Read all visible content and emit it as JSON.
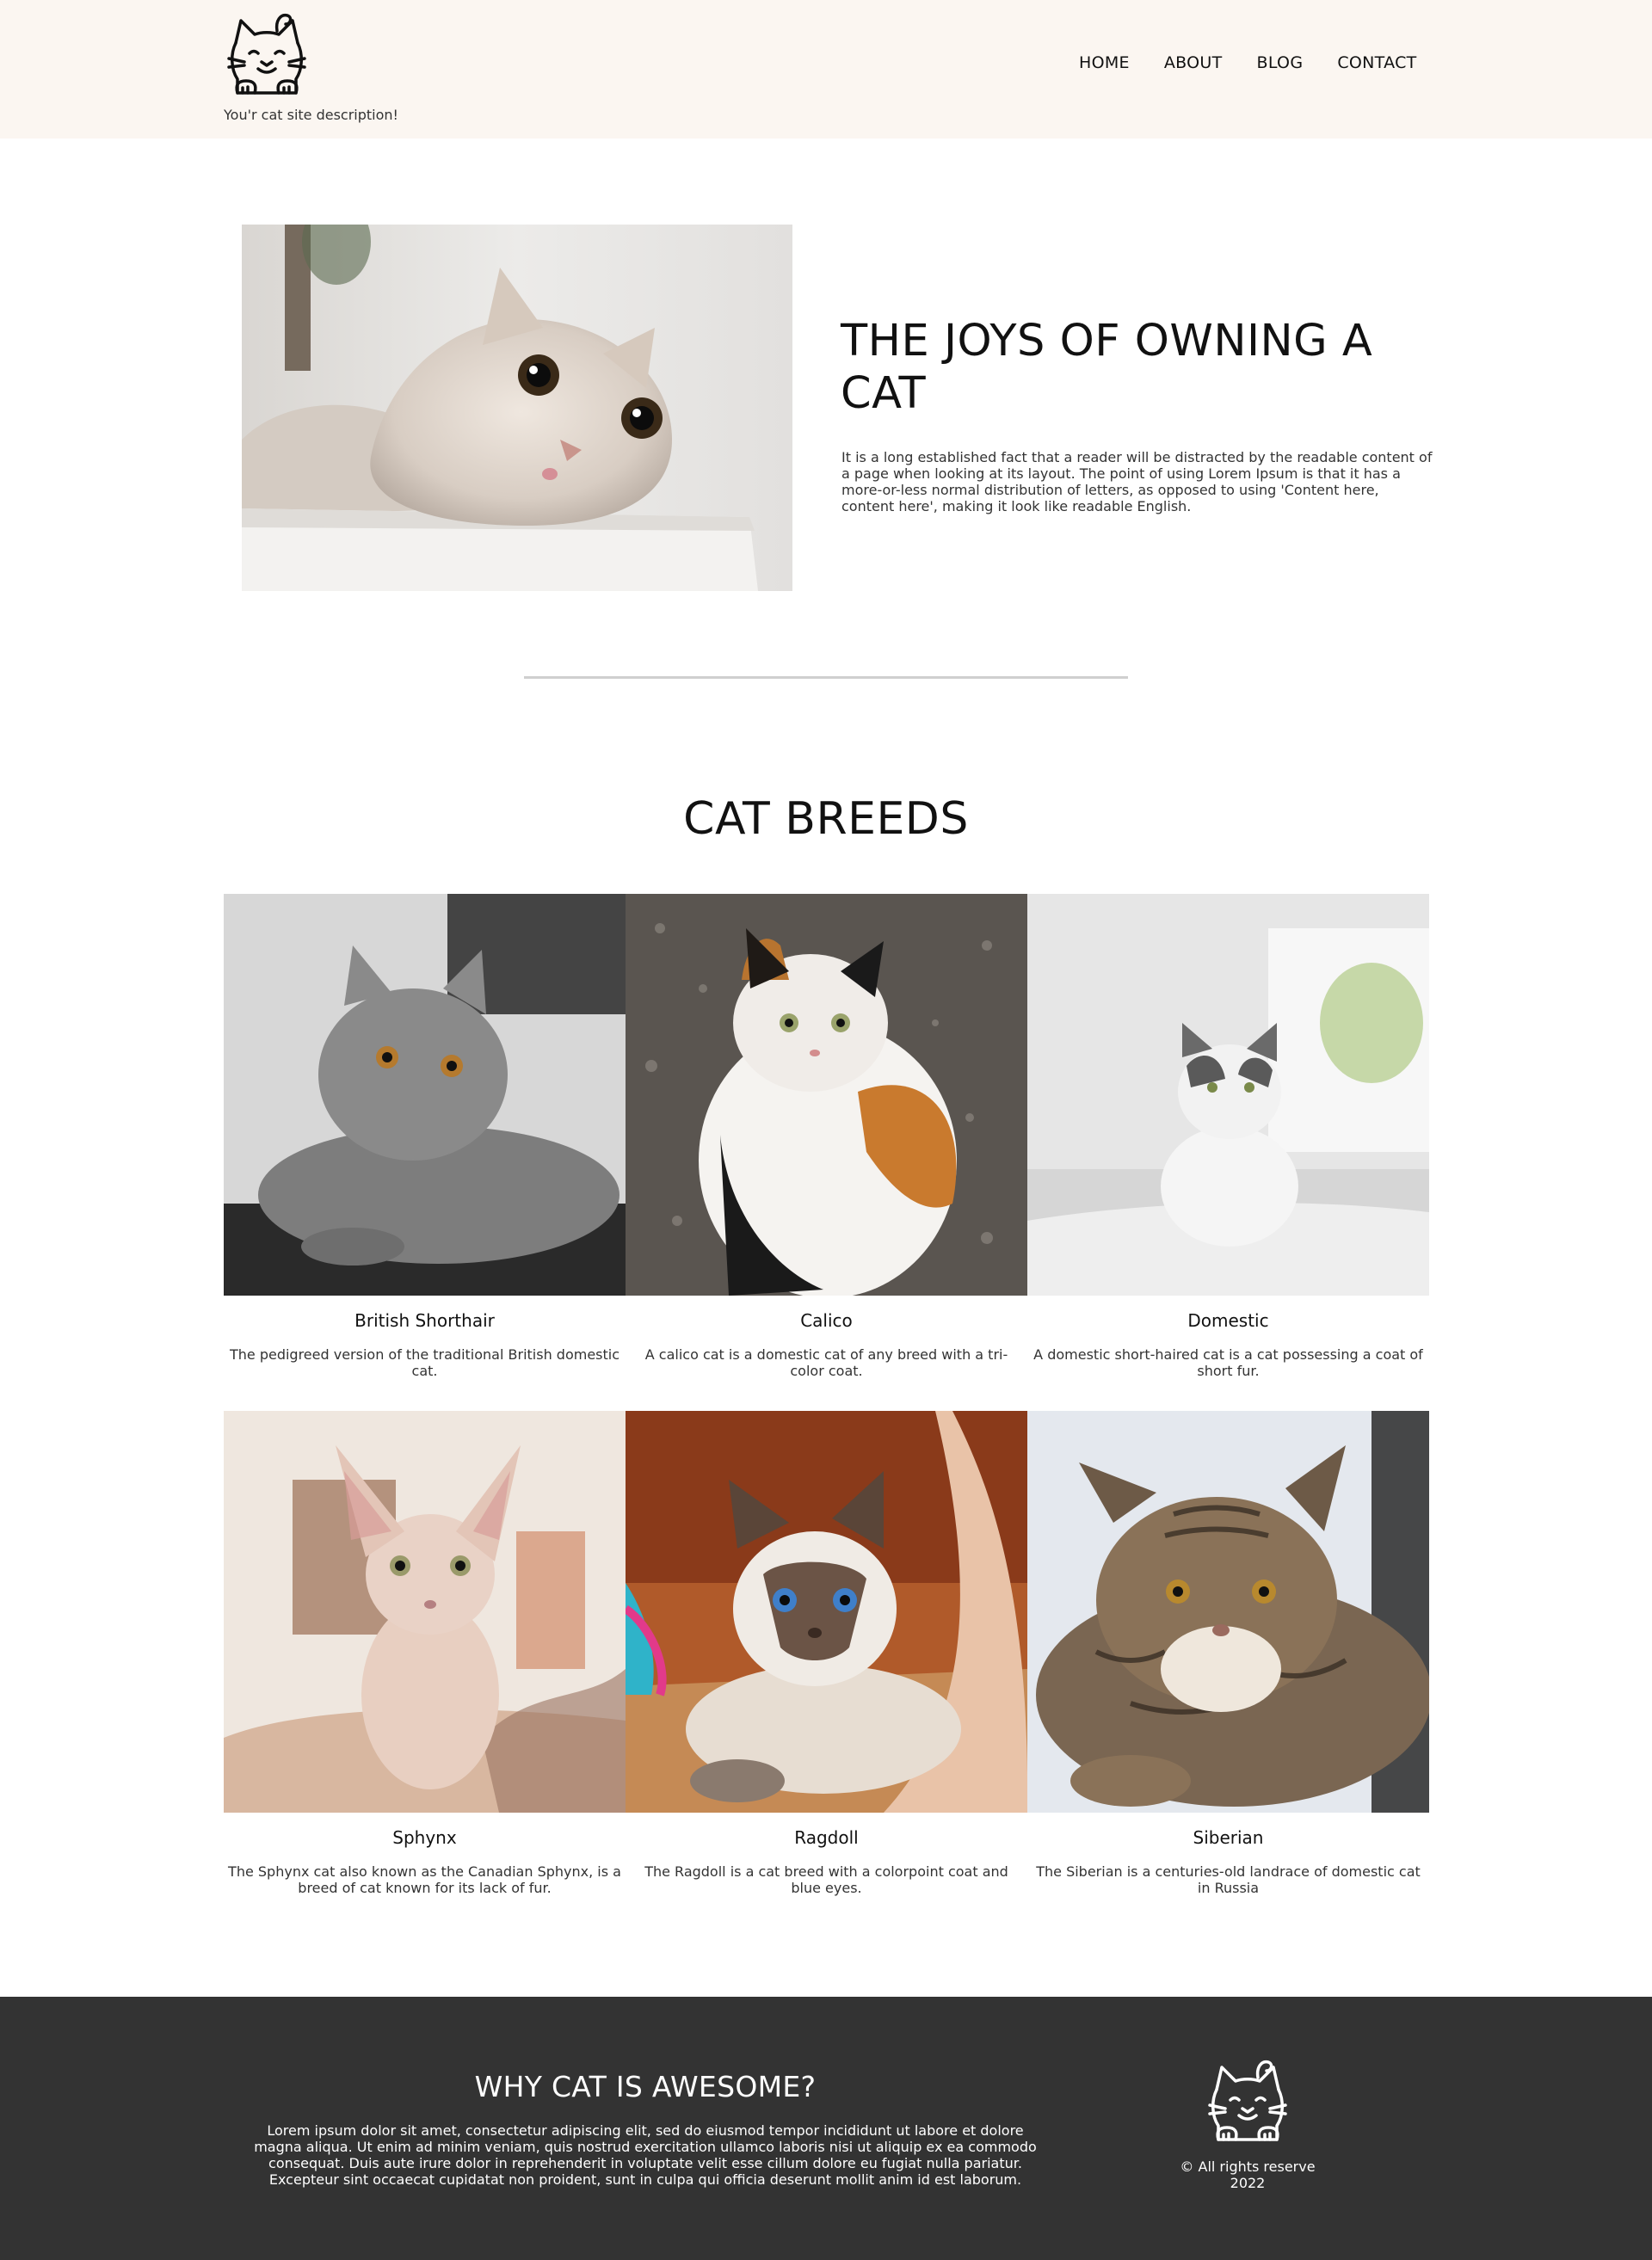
{
  "header": {
    "logo_icon": "cat-face-icon",
    "description": "You'r cat site description!",
    "nav": [
      {
        "label": "HOME"
      },
      {
        "label": "ABOUT"
      },
      {
        "label": "BLOG"
      },
      {
        "label": "CONTACT"
      }
    ]
  },
  "hero": {
    "title": "THE JOYS OF OWNING A CAT",
    "text": "It is a long established fact that a reader will be distracted by the readable content of a page when looking at its layout. The point of using Lorem Ipsum is that it has a more-or-less normal distribution of letters, as opposed to using 'Content here, content here', making it look like readable English.",
    "image": "scottish-fold-cat-photo"
  },
  "breeds": {
    "title": "CAT BREEDS",
    "items": [
      {
        "name": "British Shorthair",
        "description": "The pedigreed version of the traditional British domestic cat.",
        "image": "british-shorthair-photo"
      },
      {
        "name": "Calico",
        "description": "A calico cat is a domestic cat of any breed with a tri-color coat.",
        "image": "calico-photo"
      },
      {
        "name": "Domestic",
        "description": "A domestic short-haired cat is a cat possessing a coat of short fur.",
        "image": "domestic-photo"
      },
      {
        "name": "Sphynx",
        "description": "The Sphynx cat also known as the Canadian Sphynx, is a breed of cat known for its lack of fur.",
        "image": "sphynx-photo"
      },
      {
        "name": "Ragdoll",
        "description": "The Ragdoll is a cat breed with a colorpoint coat and blue eyes.",
        "image": "ragdoll-photo"
      },
      {
        "name": "Siberian",
        "description": "The Siberian is a centuries-old landrace of domestic cat in Russia",
        "image": "siberian-photo"
      }
    ]
  },
  "footer": {
    "title": "WHY CAT IS AWESOME?",
    "text": "Lorem ipsum dolor sit amet, consectetur adipiscing elit, sed do eiusmod tempor incididunt ut labore et dolore magna aliqua. Ut enim ad minim veniam, quis nostrud exercitation ullamco laboris nisi ut aliquip ex ea commodo consequat. Duis aute irure dolor in reprehenderit in voluptate velit esse cillum dolore eu fugiat nulla pariatur. Excepteur sint occaecat cupidatat non proident, sunt in culpa qui officia deserunt mollit anim id est laborum.",
    "logo_icon": "cat-face-icon",
    "copyright": "© All rights reserve 2022"
  },
  "colors": {
    "header_bg": "#fbf6f1",
    "footer_bg": "#333333",
    "divider": "#cfcfcf"
  }
}
